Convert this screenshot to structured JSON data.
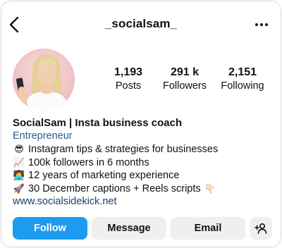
{
  "header": {
    "username": "_socialsam_"
  },
  "stats": {
    "posts": {
      "value": "1,193",
      "label": "Posts"
    },
    "followers": {
      "value": "291 k",
      "label": "Followers"
    },
    "following": {
      "value": "2,151",
      "label": "Following"
    }
  },
  "bio": {
    "name": "SocialSam | Insta business coach",
    "category": "Entrepreneur",
    "lines": [
      {
        "emoji": "😎",
        "text": "Instagram tips & strategies for businesses"
      },
      {
        "emoji": "📈",
        "text": "100k followers in 6 months"
      },
      {
        "emoji": "👩‍💻",
        "text": "12 years of marketing experience"
      },
      {
        "emoji": "🚀",
        "text": "30 December captions + Reels scripts",
        "trailing_emoji": "👇🏻"
      }
    ],
    "website": "www.socialsidekick.net"
  },
  "actions": {
    "follow": "Follow",
    "message": "Message",
    "email": "Email"
  },
  "colors": {
    "accent": "#1d9bf0",
    "secondary_button": "#efefef",
    "link": "#1b3f6b"
  }
}
